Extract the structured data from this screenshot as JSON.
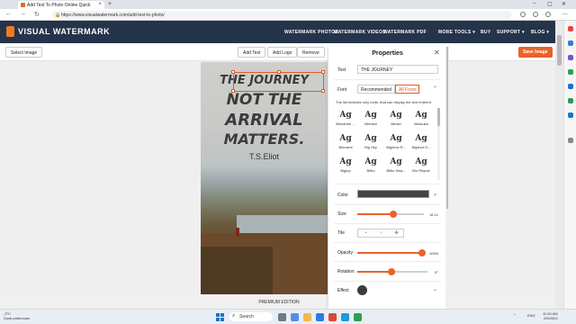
{
  "browser": {
    "tab_title": "Add Text To Photo Online Quick",
    "url": "https://www.visualwatermark.com/add-text-to-photo/"
  },
  "site": {
    "logo": "VISUAL WATERMARK",
    "nav": [
      "WATERMARK PHOTOS",
      "WATERMARK VIDEOS",
      "WATERMARK PDF",
      "MORE TOOLS ▾",
      "BUY",
      "SUPPORT ▾",
      "BLOG ▾"
    ]
  },
  "toolbar": {
    "select_image": "Select Image",
    "add_text": "Add Text",
    "add_logo": "Add Logo",
    "remove": "Remove",
    "save_image": "Save Image"
  },
  "canvas": {
    "lines": [
      "THE JOURNEY",
      "NOT THE",
      "ARRIVAL",
      "MATTERS."
    ],
    "author": "T.S.Eliot",
    "edition": "PREMIUM EDITION"
  },
  "properties": {
    "title": "Properties",
    "text_label": "Text",
    "text_value": "THE JOURNEY",
    "font_label": "Font",
    "font_tabs": [
      "Recommended",
      "All Fonts"
    ],
    "font_note": "The list includes only fonts, that can display the text entered.",
    "fonts": [
      {
        "glyph": "Ag",
        "name": "Berkshire ..."
      },
      {
        "glyph": "Ag",
        "name": "Bernica"
      },
      {
        "glyph": "Ag",
        "name": "Bevan"
      },
      {
        "glyph": "Ag",
        "name": "Bhavuka"
      },
      {
        "glyph": "Ag",
        "name": "Binowmi"
      },
      {
        "glyph": "Ag",
        "name": "Big Sky"
      },
      {
        "glyph": "Ag",
        "name": "Bigelow R..."
      },
      {
        "glyph": "Ag",
        "name": "Bigshot O..."
      },
      {
        "glyph": "Ag",
        "name": "Bigtop"
      },
      {
        "glyph": "Ag",
        "name": "Bilbo"
      },
      {
        "glyph": "Ag",
        "name": "Bilbo Swa..."
      },
      {
        "glyph": "Ag",
        "name": "Bio Rhyme"
      }
    ],
    "color_label": "Color",
    "size_label": "Size",
    "size_value": "16.1x",
    "tile_label": "Tile",
    "opacity_label": "Opacity",
    "opacity_value": "100%",
    "opacity_fraction": 1.0,
    "rotation_label": "Rotation",
    "rotation_value": "0°",
    "effect_label": "Effect",
    "text_color": "#444444",
    "accent_color": "#e8632a"
  },
  "taskbar": {
    "weather_temp": "-3°C",
    "weather_desc": "Dusk partmouse",
    "search": "Search",
    "lang": "ENG",
    "time": "11:00 AM",
    "date": "2/6/2023"
  }
}
